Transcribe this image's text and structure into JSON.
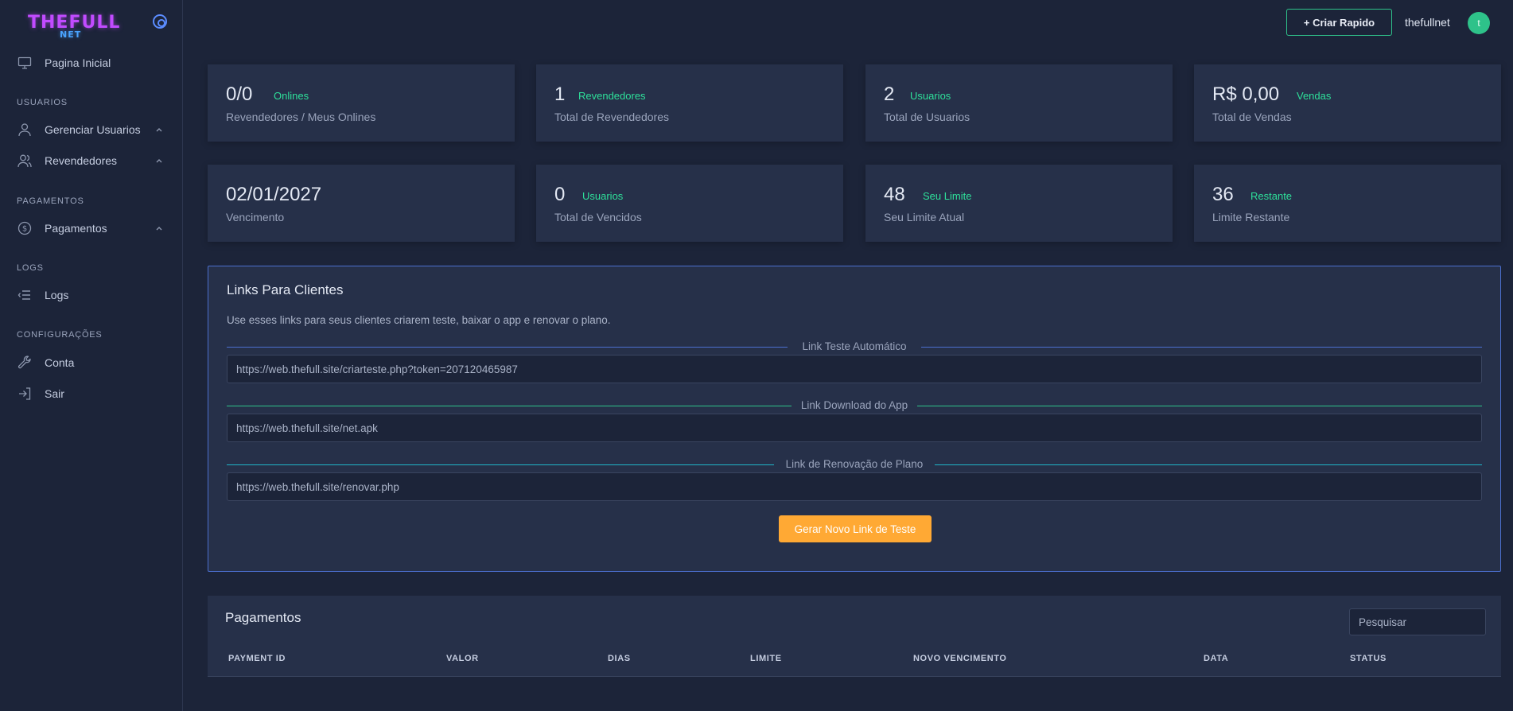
{
  "brand": {
    "logo_top": "THEFULL",
    "logo_bottom": "NET"
  },
  "sidebar": {
    "home": "Pagina Inicial",
    "section_usuarios": "USUARIOS",
    "gerenciar": "Gerenciar Usuarios",
    "revendedores": "Revendedores",
    "section_pagamentos": "PAGAMENTOS",
    "pagamentos": "Pagamentos",
    "section_logs": "LOGS",
    "logs": "Logs",
    "section_config": "CONFIGURAÇÕES",
    "conta": "Conta",
    "sair": "Sair"
  },
  "header": {
    "criar_label": "+ Criar Rapido",
    "username": "thefullnet",
    "avatar_letter": "t"
  },
  "stats": [
    {
      "value": "0/0",
      "tag": "Onlines",
      "label": "Revendedores / Meus Onlines"
    },
    {
      "value": "1",
      "tag": "Revendedores",
      "label": "Total de Revendedores"
    },
    {
      "value": "2",
      "tag": "Usuarios",
      "label": "Total de Usuarios"
    },
    {
      "value": "R$ 0,00",
      "tag": "Vendas",
      "label": "Total de Vendas"
    },
    {
      "value": "02/01/2027",
      "tag": "",
      "label": "Vencimento"
    },
    {
      "value": "0",
      "tag": "Usuarios",
      "label": "Total de Vencidos"
    },
    {
      "value": "48",
      "tag": "Seu Limite",
      "label": "Seu Limite Atual"
    },
    {
      "value": "36",
      "tag": "Restante",
      "label": "Limite Restante"
    }
  ],
  "links": {
    "title": "Links Para Clientes",
    "description": "Use esses links para seus clientes criarem teste, baixar o app e renovar o plano.",
    "teste_legend": "Link Teste Automático",
    "teste_url": "https://web.thefull.site/criarteste.php?token=207120465987",
    "download_legend": "Link Download do App",
    "download_url": "https://web.thefull.site/net.apk",
    "renovacao_legend": "Link de Renovação de Plano",
    "renovacao_url": "https://web.thefull.site/renovar.php",
    "gerar_label": "Gerar Novo Link de Teste"
  },
  "payments": {
    "title": "Pagamentos",
    "search_placeholder": "Pesquisar",
    "columns": [
      "PAYMENT ID",
      "VALOR",
      "DIAS",
      "LIMITE",
      "NOVO VENCIMENTO",
      "DATA",
      "STATUS"
    ]
  },
  "colors": {
    "background": "#1c2439",
    "card": "#263049",
    "accent_green": "#2ee09a",
    "accent_blue": "#4b6fcf",
    "accent_orange": "#ffa934",
    "logo_purple": "#c14bff"
  }
}
